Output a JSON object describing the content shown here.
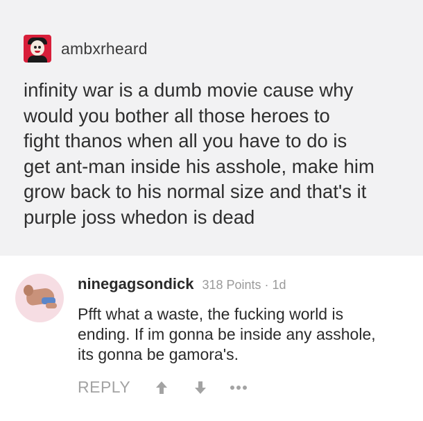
{
  "post": {
    "avatar_icon": "user-avatar-icon",
    "username": "ambxrheard",
    "lines": [
      "infinity war is a dumb movie cause why",
      "would you bother all those heroes to",
      "fight thanos when all you have to do is",
      "get ant-man inside his asshole, make him",
      "grow back to his normal size and that's it",
      "purple joss whedon is dead"
    ]
  },
  "comment": {
    "avatar_icon": "user-avatar-icon",
    "username": "ninegagsondick",
    "points": "318 Points",
    "separator": "·",
    "age": "1d",
    "lines": [
      "Pfft what a waste, the fucking world is",
      "ending. If im gonna be inside any asshole,",
      "its gonna be gamora's."
    ],
    "actions": {
      "reply_label": "REPLY",
      "upvote_icon": "arrow-up-icon",
      "downvote_icon": "arrow-down-icon",
      "more_icon": "more-dots-icon"
    }
  },
  "colors": {
    "post_background": "#f2f2f3",
    "page_background": "#ffffff",
    "muted_text": "#9a9a9a",
    "action_gray": "#a3a3a3"
  }
}
